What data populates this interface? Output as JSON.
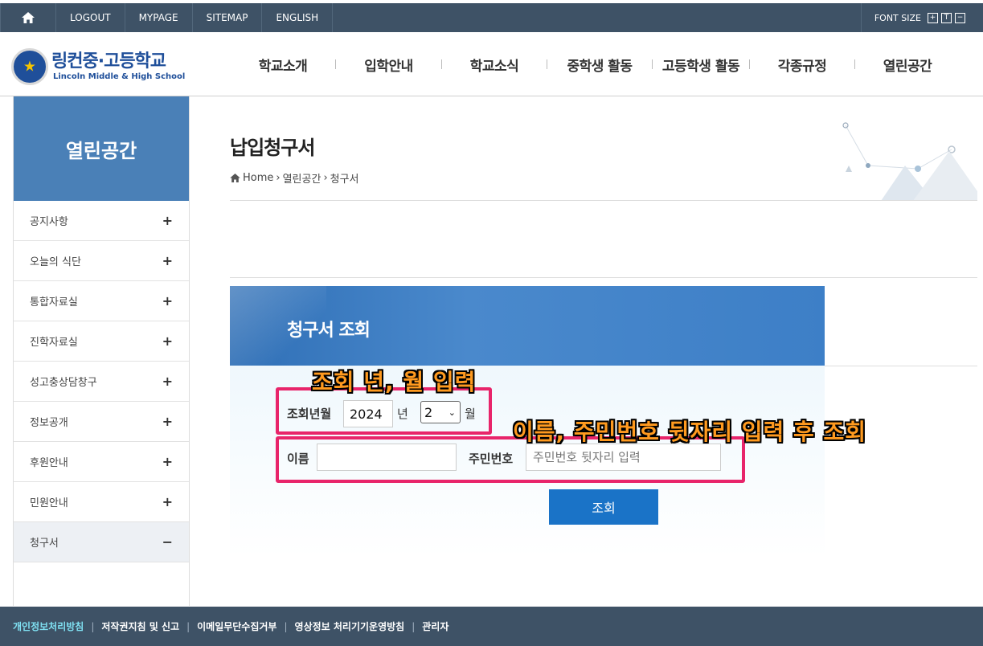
{
  "topbar": {
    "home_icon": "home-icon",
    "links": [
      "LOGOUT",
      "MYPAGE",
      "SITEMAP",
      "ENGLISH"
    ],
    "font_size_label": "FONT SIZE",
    "font_buttons": [
      "+",
      "T",
      "−"
    ]
  },
  "header": {
    "logo_name": "링컨중·고등학교",
    "logo_sub": "Lincoln Middle & High School",
    "menu": [
      "학교소개",
      "입학안내",
      "학교소식",
      "중학생 활동",
      "고등학생 활동",
      "각종규정",
      "열린공간"
    ]
  },
  "sidebar": {
    "title": "열린공간",
    "items": [
      {
        "label": "공지사항",
        "sign": "+"
      },
      {
        "label": "오늘의 식단",
        "sign": "+"
      },
      {
        "label": "통합자료실",
        "sign": "+"
      },
      {
        "label": "진학자료실",
        "sign": "+"
      },
      {
        "label": "성고충상담창구",
        "sign": "+"
      },
      {
        "label": "정보공개",
        "sign": "+"
      },
      {
        "label": "후원안내",
        "sign": "+"
      },
      {
        "label": "민원안내",
        "sign": "+"
      },
      {
        "label": "청구서",
        "sign": "−"
      }
    ]
  },
  "page": {
    "title": "납입청구서",
    "breadcrumb": [
      "Home",
      "열린공간",
      "청구서"
    ]
  },
  "form": {
    "heading": "청구서 조회",
    "period_label": "조회년월",
    "year_value": "2024",
    "year_unit": "년",
    "month_value": "2",
    "month_unit": "월",
    "name_label": "이름",
    "name_value": "",
    "ssn_label": "주민번호",
    "ssn_placeholder": "주민번호 뒷자리 입력",
    "submit_label": "조회"
  },
  "annotations": {
    "period_note": "조회 년, 월 입력",
    "identity_note": "이름, 주민번호 뒷자리 입력 후 조회"
  },
  "footer": {
    "links": [
      "개인정보처리방침",
      "저작권지침 및 신고",
      "이메일무단수집거부",
      "영상정보 처리기기운영방침",
      "관리자"
    ]
  },
  "colors": {
    "topbar": "#3e5266",
    "sidebar_title": "#4a80b7",
    "button": "#1a73c7",
    "annotation_box": "#e8246a",
    "annotation_text": "#ff9a1f"
  }
}
